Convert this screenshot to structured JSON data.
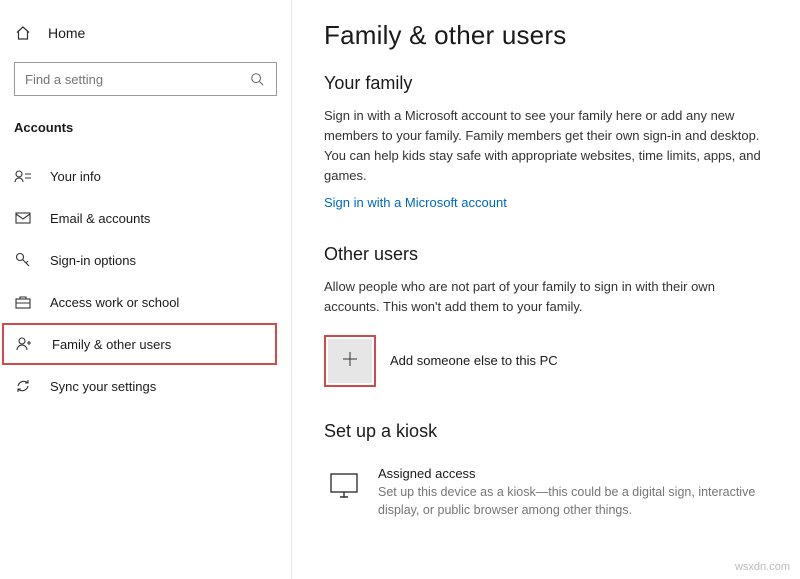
{
  "sidebar": {
    "home": "Home",
    "search_placeholder": "Find a setting",
    "section": "Accounts",
    "items": [
      {
        "label": "Your info"
      },
      {
        "label": "Email & accounts"
      },
      {
        "label": "Sign-in options"
      },
      {
        "label": "Access work or school"
      },
      {
        "label": "Family & other users"
      },
      {
        "label": "Sync your settings"
      }
    ]
  },
  "main": {
    "title": "Family & other users",
    "family": {
      "heading": "Your family",
      "body": "Sign in with a Microsoft account to see your family here or add any new members to your family. Family members get their own sign-in and desktop. You can help kids stay safe with appropriate websites, time limits, apps, and games.",
      "link": "Sign in with a Microsoft account"
    },
    "other": {
      "heading": "Other users",
      "body": "Allow people who are not part of your family to sign in with their own accounts. This won't add them to your family.",
      "add_label": "Add someone else to this PC"
    },
    "kiosk": {
      "heading": "Set up a kiosk",
      "title": "Assigned access",
      "desc": "Set up this device as a kiosk—this could be a digital sign, interactive display, or public browser among other things."
    }
  },
  "watermark": "wsxdn.com"
}
